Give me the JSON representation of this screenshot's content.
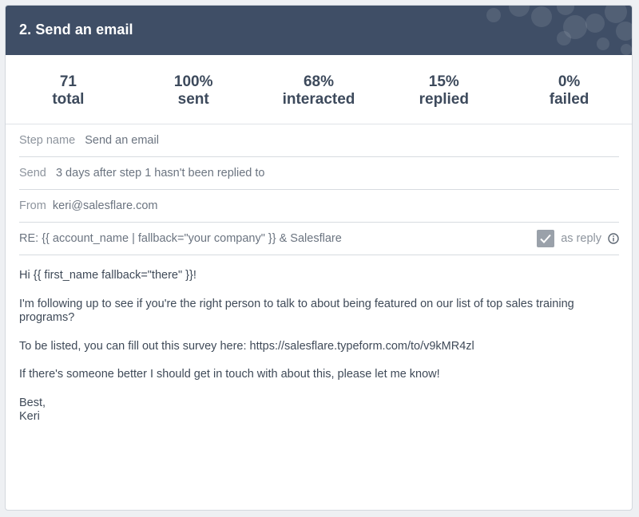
{
  "header": {
    "title": "2. Send an email"
  },
  "stats": [
    {
      "value": "71",
      "label": "total"
    },
    {
      "value": "100%",
      "label": "sent"
    },
    {
      "value": "68%",
      "label": "interacted"
    },
    {
      "value": "15%",
      "label": "replied"
    },
    {
      "value": "0%",
      "label": "failed"
    }
  ],
  "fields": {
    "step_name": {
      "label": "Step name",
      "value": "Send an email"
    },
    "send": {
      "label": "Send",
      "value": "3 days after step 1 hasn't been replied to"
    },
    "from": {
      "label": "From",
      "value": "keri@salesflare.com"
    },
    "subject": {
      "value": "RE: {{ account_name | fallback=\"your company\" }} & Salesflare"
    },
    "as_reply": {
      "label": "as reply",
      "checked": true
    }
  },
  "body": {
    "greeting": "Hi {{ first_name fallback=\"there\" }}!",
    "para1": "I'm following up to see if you're the right person to talk to about being featured on our list of top sales training programs?",
    "para2": "To be listed, you can fill out this survey here: https://salesflare.typeform.com/to/v9kMR4zl",
    "para3": "If there's someone better I should get in touch with about this, please let me know!",
    "sign_off": "Best,",
    "signature": "Keri"
  },
  "colors": {
    "header_bg": "#3f4e66",
    "text": "#3d4a5c",
    "checkbox": "#9aa1aa"
  }
}
